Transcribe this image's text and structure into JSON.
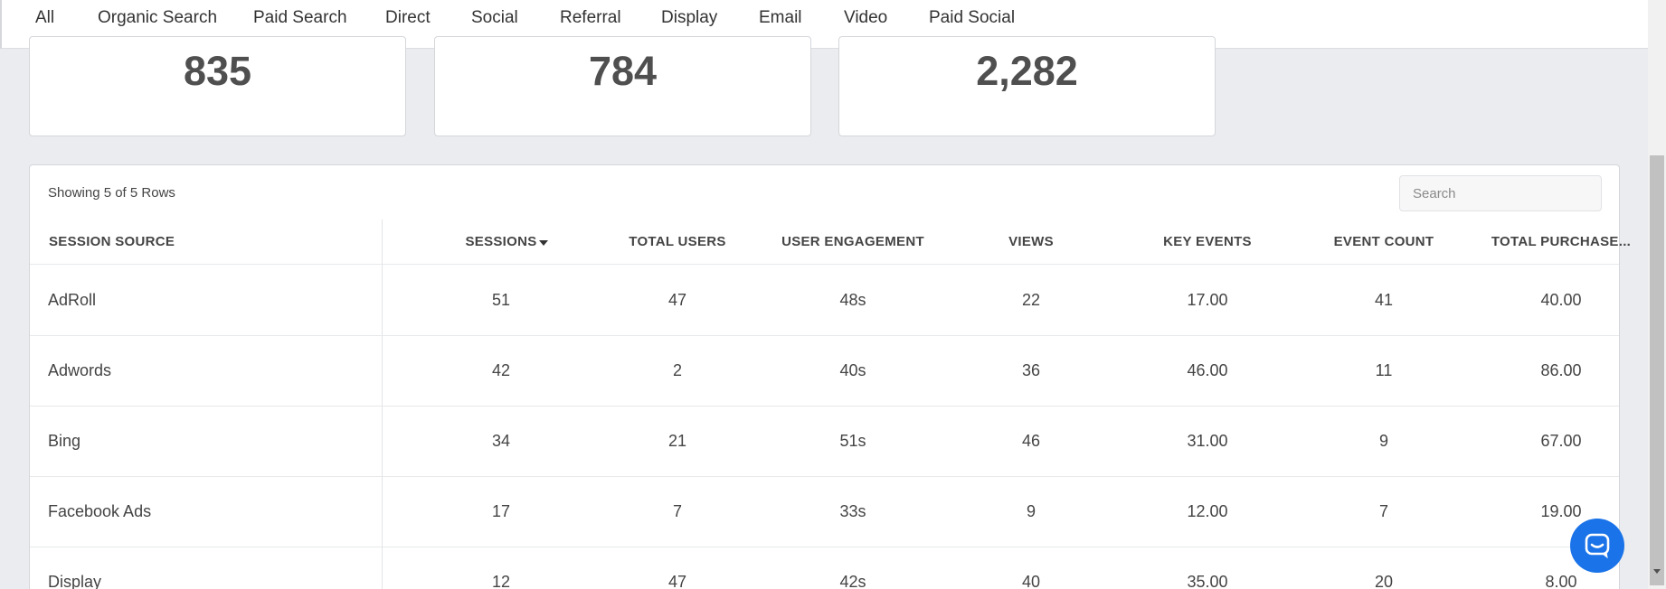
{
  "tabs": [
    {
      "label": "All",
      "active": false
    },
    {
      "label": "Organic Search",
      "active": false
    },
    {
      "label": "Paid Search",
      "active": false
    },
    {
      "label": "Direct",
      "active": false
    },
    {
      "label": "Social",
      "active": true
    },
    {
      "label": "Referral",
      "active": false
    },
    {
      "label": "Display",
      "active": false
    },
    {
      "label": "Email",
      "active": false
    },
    {
      "label": "Video",
      "active": false
    },
    {
      "label": "Paid Social",
      "active": false
    }
  ],
  "kpis": [
    "835",
    "784",
    "2,282"
  ],
  "table": {
    "rows_info": "Showing 5 of 5 Rows",
    "search_placeholder": "Search",
    "columns": [
      "SESSION SOURCE",
      "SESSIONS",
      "TOTAL USERS",
      "USER ENGAGEMENT",
      "VIEWS",
      "KEY EVENTS",
      "EVENT COUNT",
      "TOTAL PURCHASE..."
    ],
    "sorted_column": "SESSIONS",
    "sort_direction": "descending",
    "rows": [
      [
        "AdRoll",
        "51",
        "47",
        "48s",
        "22",
        "17.00",
        "41",
        "40.00"
      ],
      [
        "Adwords",
        "42",
        "2",
        "40s",
        "36",
        "46.00",
        "11",
        "86.00"
      ],
      [
        "Bing",
        "34",
        "21",
        "51s",
        "46",
        "31.00",
        "9",
        "67.00"
      ],
      [
        "Facebook Ads",
        "17",
        "7",
        "33s",
        "9",
        "12.00",
        "7",
        "19.00"
      ],
      [
        "Display",
        "12",
        "47",
        "42s",
        "40",
        "35.00",
        "20",
        "8.00"
      ]
    ]
  },
  "colors": {
    "accent": "#1a73e8",
    "background": "#ebecef"
  },
  "icons": {
    "sort": "caret-down-icon",
    "chat": "chat-bubble-icon"
  }
}
